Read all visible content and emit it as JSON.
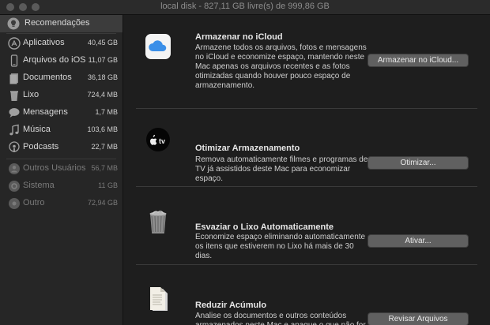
{
  "window": {
    "title": "local disk - 827,11 GB livre(s) de 999,86 GB"
  },
  "sidebar": {
    "selected": {
      "label": "Recomendações",
      "icon": "lightbulb-icon"
    },
    "items": [
      {
        "label": "Aplicativos",
        "size": "40,45 GB",
        "icon": "app-store-icon"
      },
      {
        "label": "Arquivos do iOS",
        "size": "11,07 GB",
        "icon": "phone-icon"
      },
      {
        "label": "Documentos",
        "size": "36,18 GB",
        "icon": "document-icon"
      },
      {
        "label": "Lixo",
        "size": "724,4 MB",
        "icon": "trash-icon"
      },
      {
        "label": "Mensagens",
        "size": "1,7 MB",
        "icon": "speech-bubble-icon"
      },
      {
        "label": "Música",
        "size": "103,6 MB",
        "icon": "music-note-icon"
      },
      {
        "label": "Podcasts",
        "size": "22,7 MB",
        "icon": "podcast-icon"
      }
    ],
    "other_items": [
      {
        "label": "Outros Usuários",
        "size": "56,7 MB",
        "icon": "users-icon"
      },
      {
        "label": "Sistema",
        "size": "11 GB",
        "icon": "system-gear-icon"
      },
      {
        "label": "Outro",
        "size": "72,94 GB",
        "icon": "other-disk-icon"
      }
    ]
  },
  "recommendations": [
    {
      "title": "Armazenar no iCloud",
      "description": "Armazene todos os arquivos, fotos e mensagens no iCloud e economize espaço, mantendo neste Mac apenas os arquivos recentes e as fotos otimizadas quando houver pouco espaço de armazenamento.",
      "button": "Armazenar no iCloud...",
      "icon": "icloud-icon"
    },
    {
      "title": "Otimizar Armazenamento",
      "description": "Remova automaticamente filmes e programas de TV já assistidos deste Mac para economizar espaço.",
      "button": "Otimizar...",
      "icon": "apple-tv-icon",
      "icon_text": "tv"
    },
    {
      "title": "Esvaziar o Lixo Automaticamente",
      "description": "Economize espaço eliminando automaticamente os itens que estiverem no Lixo há mais de 30 dias.",
      "button": "Ativar...",
      "icon": "full-trash-icon"
    },
    {
      "title": "Reduzir Acúmulo",
      "description": "Analise os documentos e outros conteúdos armazenados neste Mac e apague o que não for mais necessário.",
      "button": "Revisar Arquivos",
      "icon": "documents-stack-icon"
    }
  ]
}
